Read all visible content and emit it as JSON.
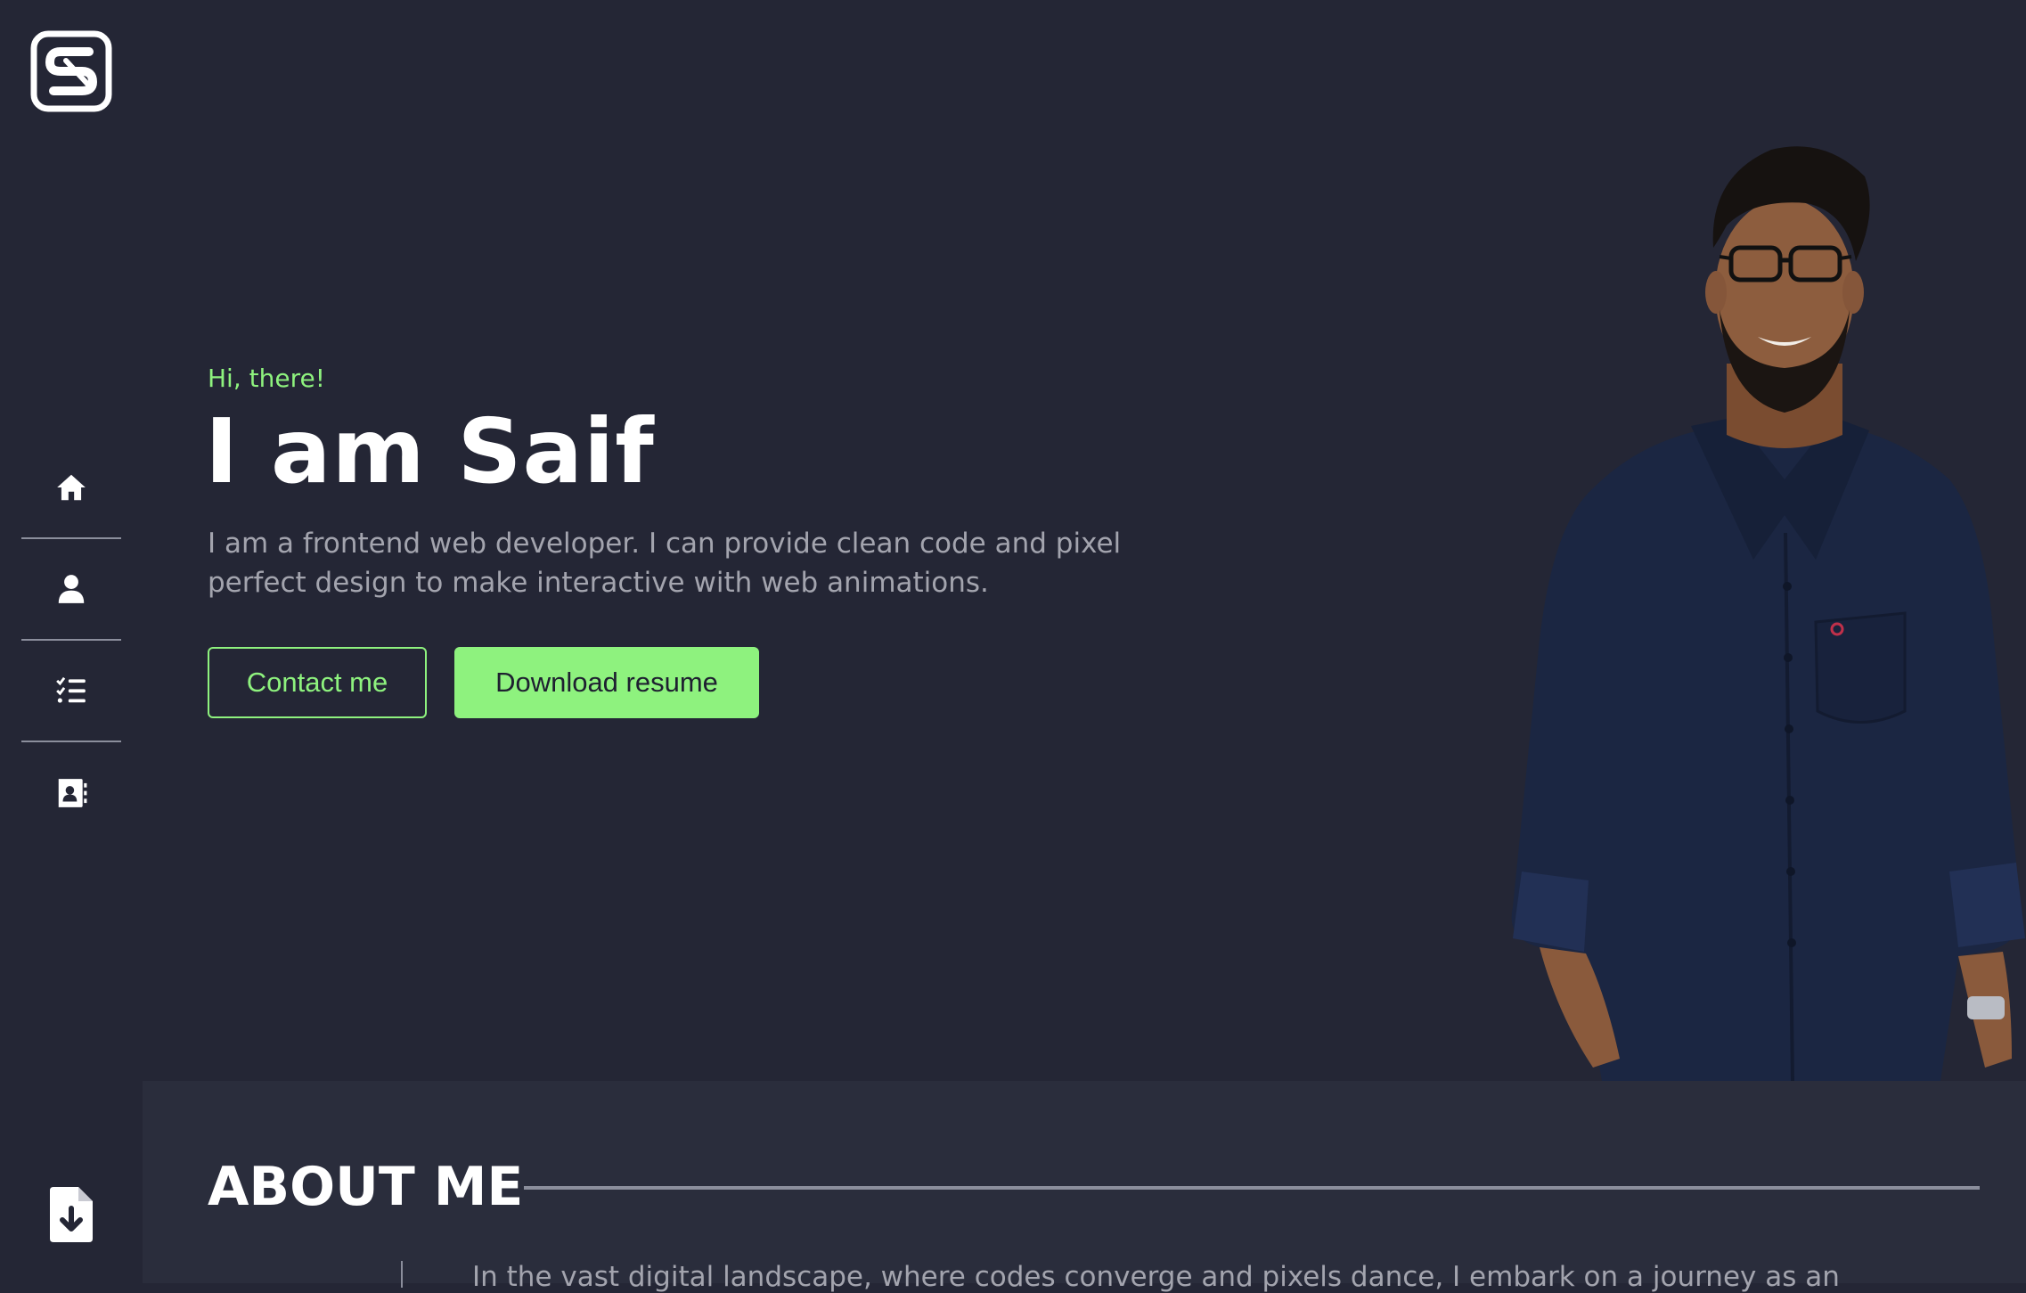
{
  "brand": {
    "logo_letter": "S",
    "accent_color": "#8ef27e",
    "background_color": "#242635"
  },
  "sidebar": {
    "items": [
      {
        "icon": "home-icon",
        "label": "Home"
      },
      {
        "icon": "user-icon",
        "label": "About"
      },
      {
        "icon": "checklist-icon",
        "label": "Skills"
      },
      {
        "icon": "contact-book-icon",
        "label": "Contact"
      }
    ],
    "resume_icon": "file-download-icon"
  },
  "hero": {
    "greeting": "Hi, there!",
    "headline": "I am Saif",
    "intro": "I am a frontend web developer. I can provide clean code and pixel perfect design to make interactive with web animations.",
    "contact_button": "Contact me",
    "download_button": "Download resume"
  },
  "about": {
    "title": "ABOUT ME",
    "text": "In the vast digital landscape, where codes converge and pixels dance, I embark on a journey as an"
  }
}
